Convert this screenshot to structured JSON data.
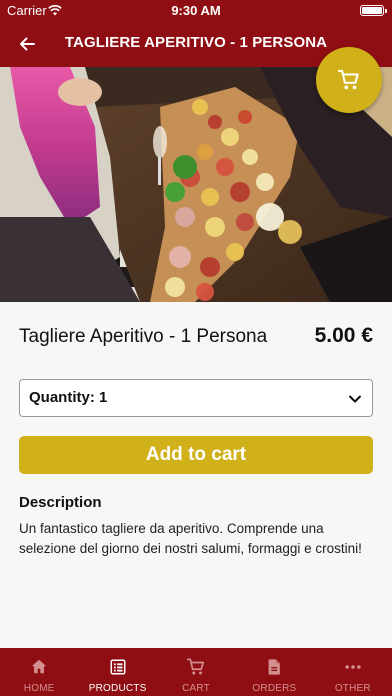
{
  "status_bar": {
    "carrier": "Carrier",
    "time": "9:30 AM"
  },
  "header": {
    "title": "TAGLIERE APERITIVO - 1 PERSONA",
    "back_icon": "arrow-left-icon"
  },
  "cart_fab": {
    "icon": "cart-icon"
  },
  "product": {
    "name": "Tagliere Aperitivo - 1 Persona",
    "price": "5.00 €"
  },
  "quantity": {
    "label": "Quantity: 1"
  },
  "add_to_cart": {
    "label": "Add to cart"
  },
  "description": {
    "title": "Description",
    "text": "Un fantastico tagliere da aperitivo. Comprende una selezione del giorno dei nostri salumi, formaggi e crostini!"
  },
  "tabbar": {
    "items": [
      {
        "label": "HOME",
        "icon": "home-icon",
        "active": false
      },
      {
        "label": "PRODUCTS",
        "icon": "list-icon",
        "active": true
      },
      {
        "label": "CART",
        "icon": "cart-icon",
        "active": false
      },
      {
        "label": "ORDERS",
        "icon": "document-icon",
        "active": false
      },
      {
        "label": "OTHER",
        "icon": "more-dots-icon",
        "active": false
      }
    ]
  },
  "colors": {
    "brand_red": "#8f0e13",
    "accent_gold": "#d1b11a",
    "tab_inactive": "#d48f90"
  }
}
